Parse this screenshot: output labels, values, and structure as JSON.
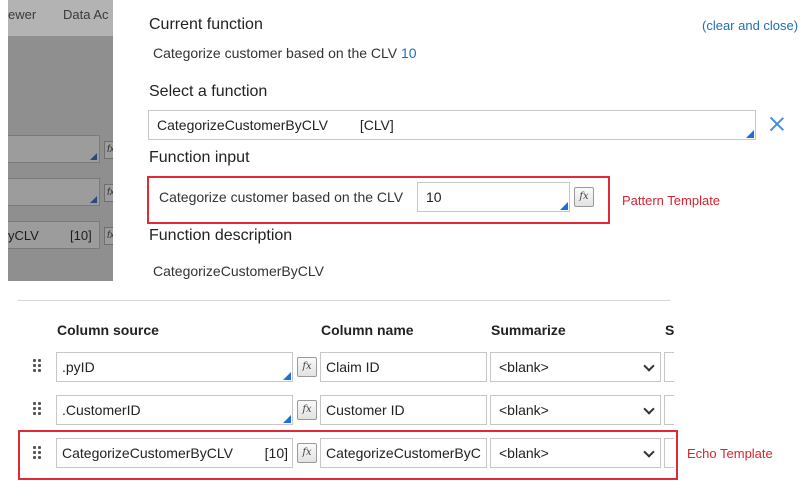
{
  "background": {
    "menu_items": [
      "ewer",
      "Data Ac"
    ],
    "row_text": "yCLV",
    "row_value": "[10]",
    "fx_glyph": "fx"
  },
  "dialog": {
    "current_function_heading": "Current function",
    "current_function_text": "Categorize customer based on the CLV",
    "current_function_value": "10",
    "clear_link": "(clear and close)",
    "select_function_heading": "Select a function",
    "select_function_value": "CategorizeCustomerByCLV",
    "select_function_tag": "[CLV]",
    "function_input_heading": "Function input",
    "function_input_label": "Categorize customer based on the CLV",
    "function_input_value": "10",
    "fx_glyph": "fx",
    "pattern_template_label": "Pattern Template",
    "function_description_heading": "Function description",
    "function_description_text": "CategorizeCustomerByCLV"
  },
  "columns": {
    "headers": [
      "Column source",
      "Column name",
      "Summarize",
      "S"
    ],
    "rows": [
      {
        "source": ".pyID",
        "source_suffix": "",
        "name": "Claim ID",
        "summarize": "<blank>"
      },
      {
        "source": ".CustomerID",
        "source_suffix": "",
        "name": "Customer ID",
        "summarize": "<blank>"
      },
      {
        "source": "CategorizeCustomerByCLV",
        "source_suffix": "[10]",
        "name": "CategorizeCustomerByC",
        "summarize": "<blank>"
      }
    ],
    "echo_template_label": "Echo Template"
  },
  "colors": {
    "accent_blue": "#1f6fb5",
    "highlight_red": "#e02a36",
    "field_corner_blue": "#1f6fd8"
  }
}
